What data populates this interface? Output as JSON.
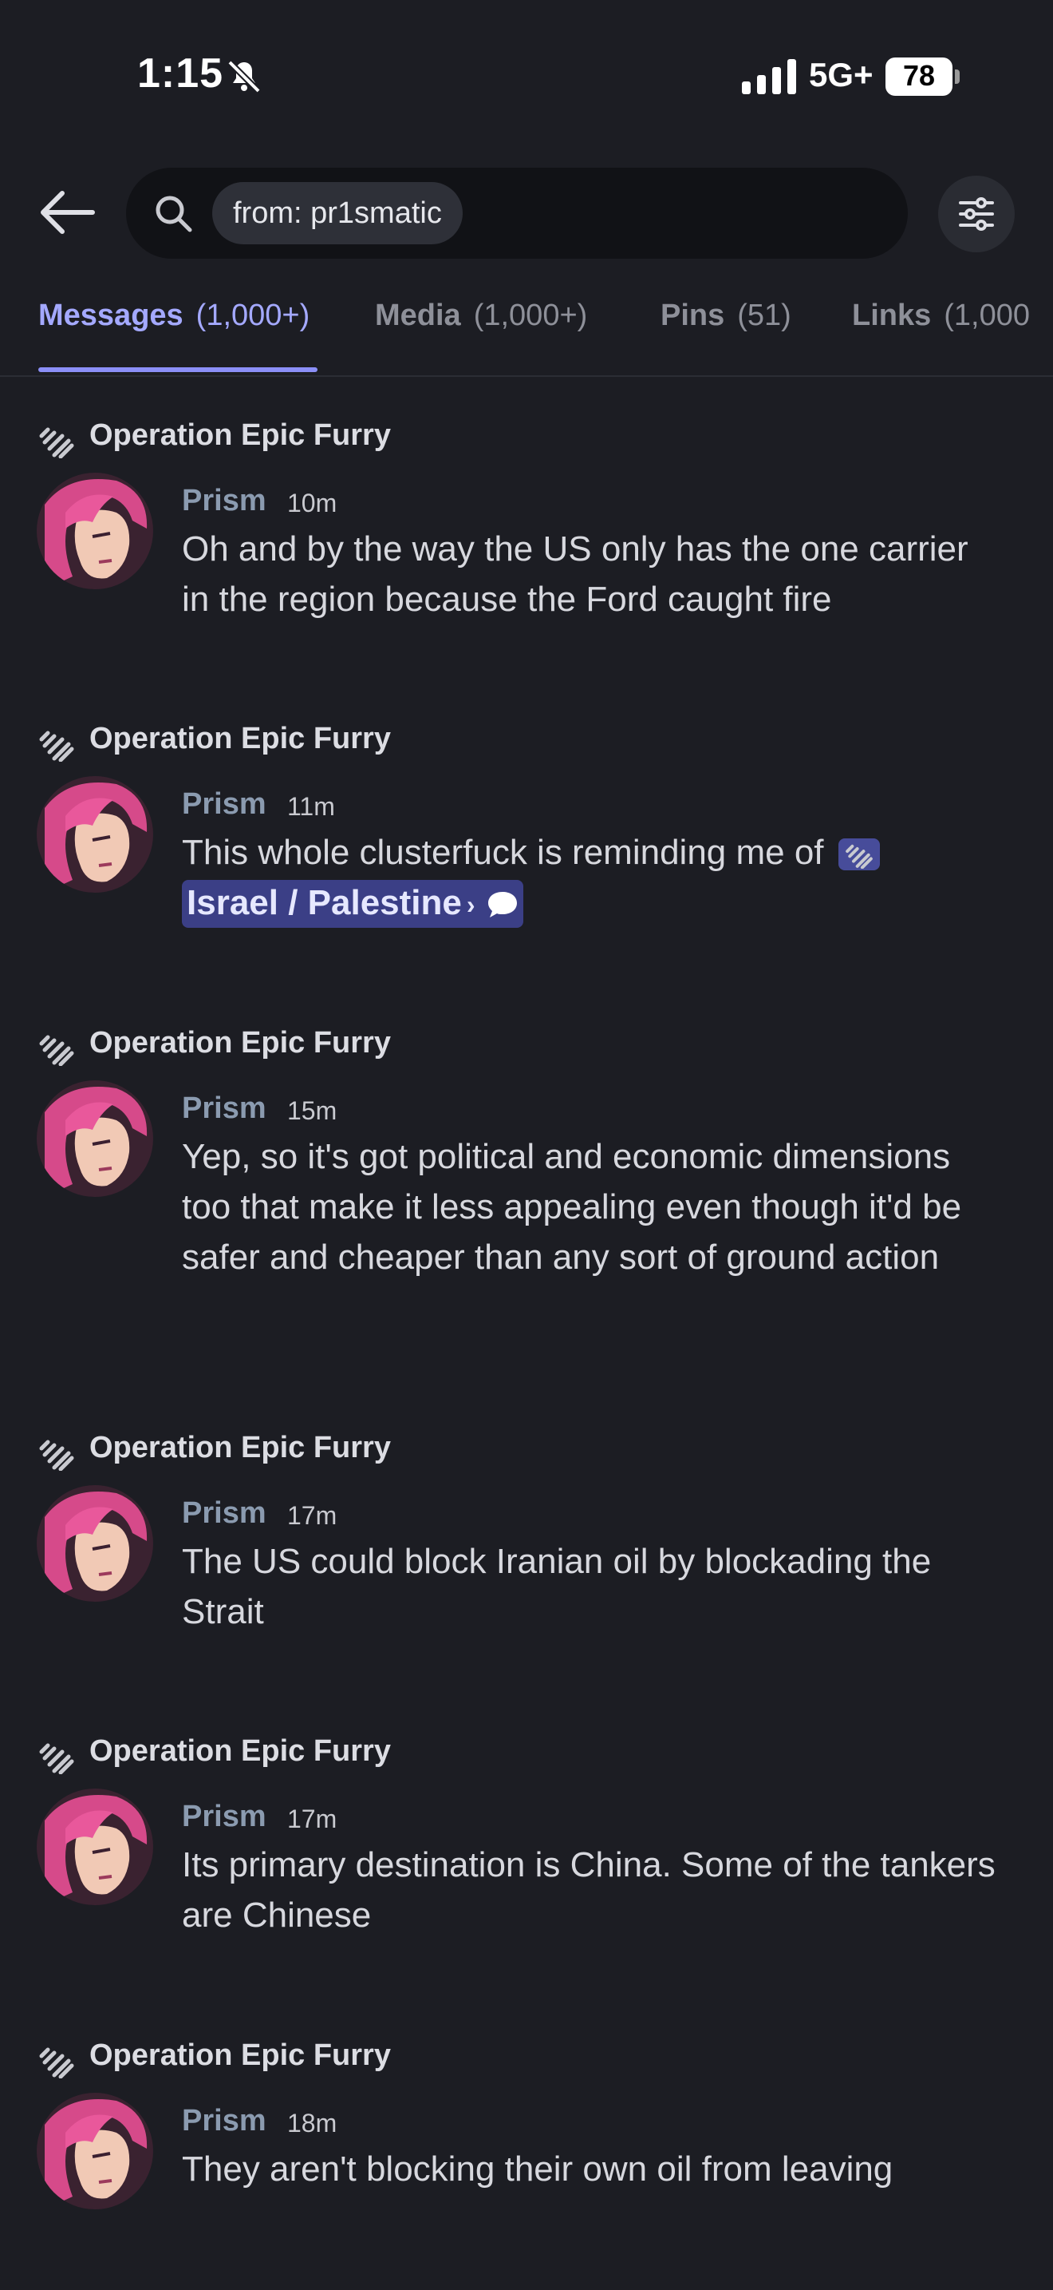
{
  "status_bar": {
    "time": "1:15",
    "network": "5G+",
    "battery": "78"
  },
  "search": {
    "chip": "from: pr1smatic"
  },
  "tabs": [
    {
      "label": "Messages",
      "count": "(1,000+)"
    },
    {
      "label": "Media",
      "count": "(1,000+)"
    },
    {
      "label": "Pins",
      "count": "(51)"
    },
    {
      "label": "Links",
      "count": "(1,000"
    }
  ],
  "results": [
    {
      "channel": "Operation Epic Furry",
      "author": "Prism",
      "time": "10m",
      "text": "Oh and by the way the US only has the one carrier in the region because the Ford caught fire"
    },
    {
      "channel": "Operation Epic Furry",
      "author": "Prism",
      "time": "11m",
      "text": "This whole clusterfuck is reminding me of",
      "mention": "Israel / Palestine"
    },
    {
      "channel": "Operation Epic Furry",
      "author": "Prism",
      "time": "15m",
      "text": "Yep, so it's got political and economic dimensions too that make it less appealing even though it'd be safer and cheaper than any sort of ground action"
    },
    {
      "channel": "Operation Epic Furry",
      "author": "Prism",
      "time": "17m",
      "text": "The US could block Iranian oil by blockading the Strait"
    },
    {
      "channel": "Operation Epic Furry",
      "author": "Prism",
      "time": "17m",
      "text": "Its primary destination is China. Some of the tankers are Chinese"
    },
    {
      "channel": "Operation Epic Furry",
      "author": "Prism",
      "time": "18m",
      "text": "They aren't blocking their own oil from leaving"
    }
  ]
}
